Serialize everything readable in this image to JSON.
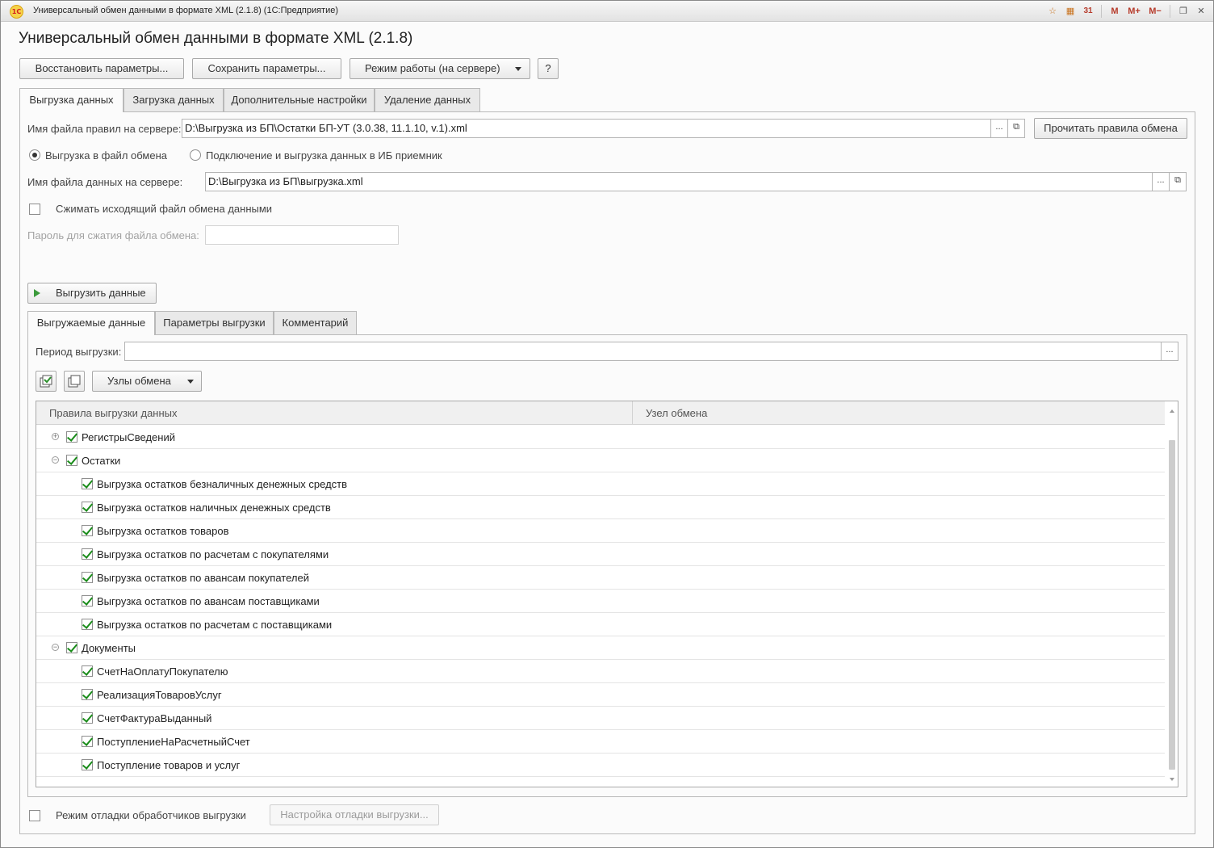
{
  "window": {
    "title": "Универсальный обмен данными в формате XML (2.1.8)  (1С:Предприятие)",
    "logo_text": "1С",
    "toolbar_icons": [
      "favorites-icon",
      "calculator-icon",
      "calendar-icon",
      "memory-icon",
      "memory-plus-icon",
      "memory-minus-icon",
      "restore-window-icon",
      "close-window-icon"
    ],
    "toolbar_glyphs": {
      "favorites": "☆",
      "calculator": "▦",
      "calendar": "31",
      "memory": "M",
      "memory_plus": "M+",
      "memory_minus": "M−",
      "restore": "❐",
      "close": "✕"
    }
  },
  "page": {
    "title": "Универсальный обмен данными в формате XML (2.1.8)"
  },
  "commandbar": {
    "restore_label": "Восстановить параметры...",
    "save_label": "Сохранить параметры...",
    "mode_label": "Режим работы (на сервере)",
    "help_label": "?"
  },
  "tabs": [
    {
      "label": "Выгрузка данных",
      "active": true
    },
    {
      "label": "Загрузка данных",
      "active": false
    },
    {
      "label": "Дополнительные настройки",
      "active": false
    },
    {
      "label": "Удаление данных",
      "active": false
    }
  ],
  "export": {
    "rules_file_label": "Имя файла правил на сервере:",
    "rules_file_value": "D:\\Выгрузка из БП\\Остатки БП-УТ (3.0.38, 11.1.10, v.1).xml",
    "select_btn": "...",
    "open_btn": "⧉",
    "read_rules_label": "Прочитать правила обмена",
    "mode_option_file": "Выгрузка в файл обмена",
    "mode_option_ib": "Подключение и выгрузка данных в ИБ приемник",
    "data_file_label": "Имя файла данных на сервере:",
    "data_file_value": "D:\\Выгрузка из БП\\выгрузка.xml",
    "compress_label": "Сжимать исходящий файл обмена данными",
    "password_label": "Пароль для сжатия файла обмена:",
    "password_value": "",
    "export_button_label": "Выгрузить данные"
  },
  "subtabs": [
    {
      "label": "Выгружаемые данные",
      "active": true
    },
    {
      "label": "Параметры выгрузки",
      "active": false
    },
    {
      "label": "Комментарий",
      "active": false
    }
  ],
  "period": {
    "label": "Период выгрузки:",
    "value": "",
    "select_btn": "..."
  },
  "nodes_toolbar": {
    "nodes_label": "Узлы обмена"
  },
  "grid": {
    "columns": [
      "Правила выгрузки данных",
      "Узел обмена"
    ],
    "rows": [
      {
        "level": 0,
        "toggle": "+",
        "checked": true,
        "label": "РегистрыСведений"
      },
      {
        "level": 0,
        "toggle": "−",
        "checked": true,
        "label": "Остатки"
      },
      {
        "level": 1,
        "toggle": "",
        "checked": true,
        "label": "Выгрузка остатков безналичных денежных средств"
      },
      {
        "level": 1,
        "toggle": "",
        "checked": true,
        "label": "Выгрузка остатков наличных денежных средств"
      },
      {
        "level": 1,
        "toggle": "",
        "checked": true,
        "label": "Выгрузка остатков товаров"
      },
      {
        "level": 1,
        "toggle": "",
        "checked": true,
        "label": "Выгрузка остатков по расчетам с покупателями"
      },
      {
        "level": 1,
        "toggle": "",
        "checked": true,
        "label": "Выгрузка остатков по авансам покупателей"
      },
      {
        "level": 1,
        "toggle": "",
        "checked": true,
        "label": "Выгрузка остатков по авансам поставщиками"
      },
      {
        "level": 1,
        "toggle": "",
        "checked": true,
        "label": "Выгрузка остатков по расчетам с поставщиками"
      },
      {
        "level": 0,
        "toggle": "−",
        "checked": true,
        "label": "Документы"
      },
      {
        "level": 1,
        "toggle": "",
        "checked": true,
        "label": "СчетНаОплатуПокупателю"
      },
      {
        "level": 1,
        "toggle": "",
        "checked": true,
        "label": "РеализацияТоваровУслуг"
      },
      {
        "level": 1,
        "toggle": "",
        "checked": true,
        "label": "СчетФактураВыданный"
      },
      {
        "level": 1,
        "toggle": "",
        "checked": true,
        "label": "ПоступлениеНаРасчетныйСчет"
      },
      {
        "level": 1,
        "toggle": "",
        "checked": true,
        "label": "Поступление товаров и услуг"
      }
    ]
  },
  "debug": {
    "debug_mode_label": "Режим отладки обработчиков выгрузки",
    "debug_settings_label": "Настройка отладки выгрузки..."
  }
}
